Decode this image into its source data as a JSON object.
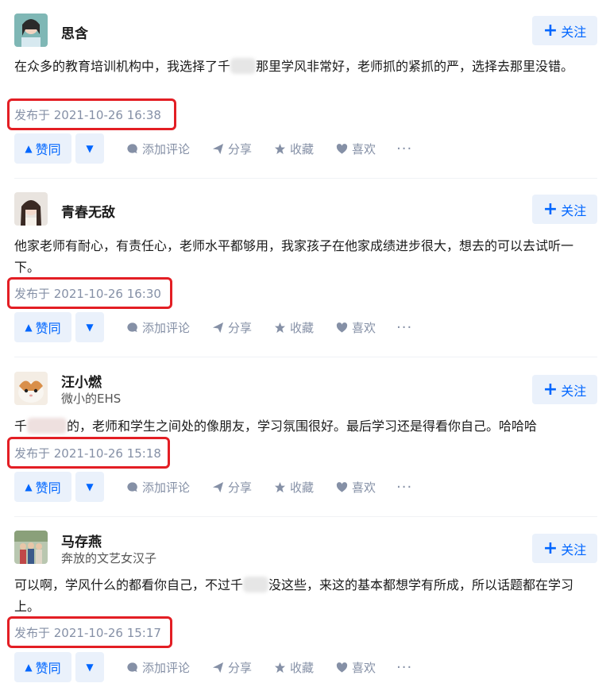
{
  "follow_label": "关注",
  "follow_plus": "+",
  "actions": {
    "upvote": "赞同",
    "upvote_arrow": "▲",
    "downvote_arrow": "▼",
    "comment": "添加评论",
    "share": "分享",
    "collect": "收藏",
    "like": "喜欢",
    "more": "···"
  },
  "colors": {
    "accent": "#0066ff",
    "highlight_box": "#e31e24",
    "meta": "#8590a6"
  },
  "answers": [
    {
      "name": "思含",
      "bio": "",
      "content_a": "在众多的教育培训机构中，我选择了千",
      "content_b": "那里学风非常好，老师抓的紧抓的严，选择去那里没错。",
      "time": "发布于 2021-10-26 16:38"
    },
    {
      "name": "青春无敌",
      "bio": "",
      "content_a": "他家老师有耐心，有责任心，老师水平都够用，我家孩子在他家成绩进步很大，想去的可以去试听一下。",
      "content_b": "",
      "time": "发布于 2021-10-26 16:30"
    },
    {
      "name": "汪小燃",
      "bio": "微小的EHS",
      "content_a": "千",
      "content_b": "的，老师和学生之间处的像朋友，学习氛围很好。最后学习还是得看你自己。哈哈哈",
      "time": "发布于 2021-10-26 15:18"
    },
    {
      "name": "马存燕",
      "bio": "奔放的文艺女汉子",
      "content_a": "可以啊，学风什么的都看你自己，不过千",
      "content_b": "没这些，来这的基本都想学有所成，所以话题都在学习上。",
      "time": "发布于 2021-10-26 15:17"
    }
  ]
}
